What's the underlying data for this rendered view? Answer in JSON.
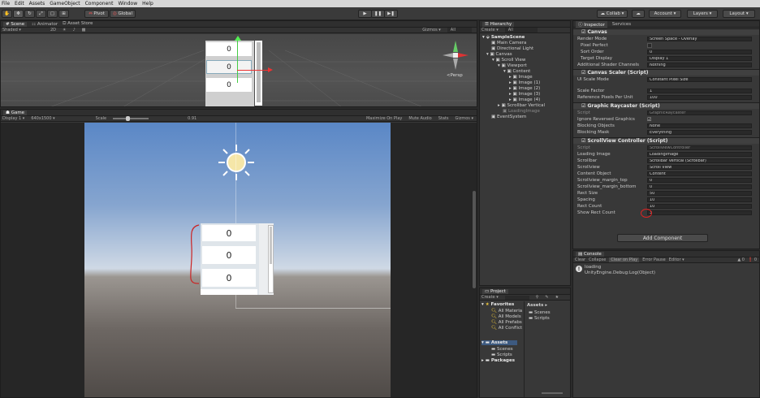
{
  "menu": [
    "File",
    "Edit",
    "Assets",
    "GameObject",
    "Component",
    "Window",
    "Help"
  ],
  "toolbar": {
    "pivot": "Pivot",
    "global": "Global",
    "collab": "Collab",
    "account": "Account",
    "layers": "Layers",
    "layout": "Layout"
  },
  "scene": {
    "tabs": [
      "Scene",
      "Animator",
      "Asset Store"
    ],
    "shading": "Shaded",
    "mode2d": "2D",
    "gizmos": "Gizmos",
    "search": "All",
    "persp": "<Persp",
    "cells": [
      "0",
      "0",
      "0"
    ]
  },
  "game": {
    "tab": "Game",
    "display": "Display 1",
    "resolution": "640x1500",
    "scale_label": "Scale",
    "scale_value": "0.91",
    "options": [
      "Maximize On Play",
      "Mute Audio",
      "Stats",
      "Gizmos"
    ],
    "cells": [
      "0",
      "0",
      "0"
    ]
  },
  "hierarchy": {
    "tab": "Hierarchy",
    "create": "Create",
    "search": "All",
    "items": [
      "SampleScene",
      "Main Camera",
      "Directional Light",
      "Canvas",
      "Scroll View",
      "Viewport",
      "Content",
      "Image",
      "Image (1)",
      "Image (2)",
      "Image (3)",
      "Image (4)",
      "Scrollbar Vertical",
      "LoadingImage",
      "EventSystem"
    ]
  },
  "project": {
    "tab": "Project",
    "create": "Create",
    "favorites": "Favorites",
    "fav_items": [
      "All Materia",
      "All Models",
      "All Prefabs",
      "All Conflict"
    ],
    "assets": "Assets",
    "asset_items": [
      "Scenes",
      "Scripts"
    ],
    "packages": "Packages",
    "assets_header": "Assets",
    "right_items": [
      "Scenes",
      "Scripts"
    ]
  },
  "inspector": {
    "tabs": [
      "Inspector",
      "Services"
    ],
    "canvas": {
      "title": "Canvas",
      "rows": [
        [
          "Render Mode",
          "Screen Space - Overlay"
        ],
        [
          "Pixel Perfect",
          ""
        ],
        [
          "Sort Order",
          "0"
        ],
        [
          "Target Display",
          "Display 1"
        ],
        [
          "Additional Shader Channels",
          "Nothing"
        ]
      ]
    },
    "scaler": {
      "title": "Canvas Scaler (Script)",
      "rows": [
        [
          "UI Scale Mode",
          "Constant Pixel Size"
        ],
        [
          "Scale Factor",
          "1"
        ],
        [
          "Reference Pixels Per Unit",
          "100"
        ]
      ]
    },
    "raycaster": {
      "title": "Graphic Raycaster (Script)",
      "rows": [
        [
          "Script",
          "GraphicRaycaster"
        ],
        [
          "Ignore Reversed Graphics",
          ""
        ],
        [
          "Blocking Objects",
          "None"
        ],
        [
          "Blocking Mask",
          "Everything"
        ]
      ]
    },
    "controller": {
      "title": "ScrollView Controller (Script)",
      "rows": [
        [
          "Script",
          "ScrollViewController"
        ],
        [
          "Loading Image",
          "LoadingImage"
        ],
        [
          "Scrollbar",
          "Scrollbar Vertical (Scrollbar)"
        ],
        [
          "Scrollview",
          "Scroll View"
        ],
        [
          "Content Object",
          "Content"
        ],
        [
          "Scrollview_margin_top",
          "0"
        ],
        [
          "Scrollview_margin_bottom",
          "0"
        ],
        [
          "Rect Size",
          "50"
        ],
        [
          "Spacing",
          "10"
        ],
        [
          "Rect Count",
          "10"
        ],
        [
          "Show Rect Count",
          "3"
        ]
      ]
    },
    "add_component": "Add Component"
  },
  "console": {
    "tab": "Console",
    "buttons": [
      "Clear",
      "Collapse",
      "Clear on Play",
      "Error Pause",
      "Editor"
    ],
    "counts": [
      "0",
      "0"
    ],
    "log_line1": "loading",
    "log_line2": "UnityEngine.Debug:Log(Object)"
  }
}
